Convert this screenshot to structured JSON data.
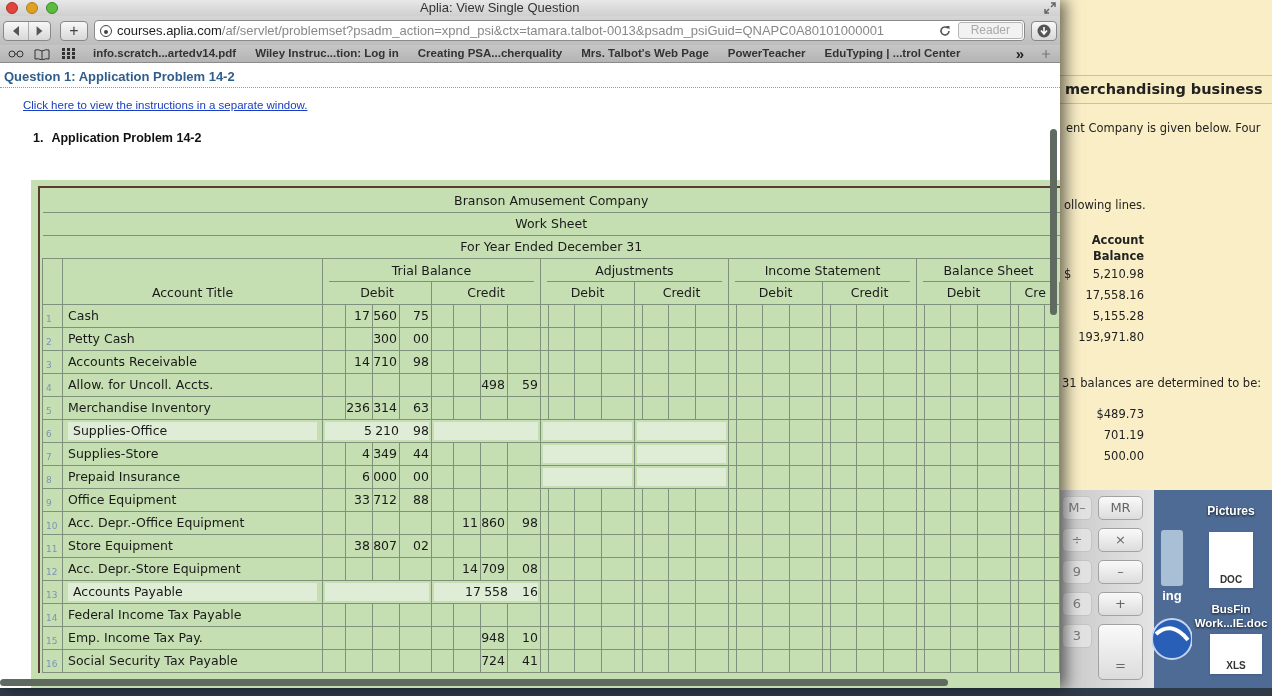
{
  "browser": {
    "title": "Aplia: View Single Question",
    "add_tab": "+",
    "url_host": "courses.aplia.com",
    "url_path": "/af/servlet/problemset?psadm_action=xpnd_psi&ctx=tamara.talbot-0013&psadm_psiGuid=QNAPC0A80101000001",
    "reader": "Reader",
    "bookmarks": [
      "info.scratch...artedv14.pdf",
      "Wiley Instruc...tion: Log in",
      "Creating PSA...cherquality",
      "Mrs. Talbot's Web Page",
      "PowerTeacher",
      "EduTyping | ...trol Center"
    ],
    "more": "»"
  },
  "page": {
    "question_title": "Question 1: Application Problem 14-2",
    "instructions_link": "Click here to view the instructions in a separate window.",
    "problem_number": "1.",
    "problem_title": "Application Problem 14-2"
  },
  "worksheet": {
    "company": "Branson Amusement Company",
    "title": "Work Sheet",
    "period": "For Year Ended December 31",
    "account_title": "Account Title",
    "sections": [
      {
        "name": "Trial Balance",
        "sides": [
          "Debit",
          "Credit"
        ]
      },
      {
        "name": "Adjustments",
        "sides": [
          "Debit",
          "Credit"
        ]
      },
      {
        "name": "Income Statement",
        "sides": [
          "Debit",
          "Credit"
        ]
      },
      {
        "name": "Balance Sheet",
        "sides": [
          "Debit",
          "Cre"
        ]
      }
    ],
    "rows": [
      {
        "num": "1",
        "title": "Cash",
        "input": false,
        "adj_input": false,
        "debit": {
          "thousands": "17",
          "units": "560",
          "cents": "75"
        }
      },
      {
        "num": "2",
        "title": "Petty Cash",
        "input": false,
        "adj_input": false,
        "debit": {
          "units": "300",
          "cents": "00"
        }
      },
      {
        "num": "3",
        "title": "Accounts Receivable",
        "input": false,
        "adj_input": false,
        "debit": {
          "thousands": "14",
          "units": "710",
          "cents": "98"
        }
      },
      {
        "num": "4",
        "title": "Allow. for Uncoll. Accts.",
        "input": false,
        "adj_input": false,
        "credit": {
          "units": "498",
          "cents": "59"
        }
      },
      {
        "num": "5",
        "title": "Merchandise Inventory",
        "input": false,
        "adj_input": false,
        "debit": {
          "thousands": "236",
          "units": "314",
          "cents": "63"
        }
      },
      {
        "num": "6",
        "title": "Supplies-Office",
        "input": true,
        "adj_input": true,
        "debit": {
          "thousands": "5",
          "units": "210",
          "cents": "98"
        }
      },
      {
        "num": "7",
        "title": "Supplies-Store",
        "input": false,
        "adj_input": true,
        "debit": {
          "thousands": "4",
          "units": "349",
          "cents": "44"
        }
      },
      {
        "num": "8",
        "title": "Prepaid Insurance",
        "input": false,
        "adj_input": true,
        "debit": {
          "thousands": "6",
          "units": "000",
          "cents": "00"
        }
      },
      {
        "num": "9",
        "title": "Office Equipment",
        "input": false,
        "adj_input": false,
        "debit": {
          "thousands": "33",
          "units": "712",
          "cents": "88"
        }
      },
      {
        "num": "10",
        "title": "Acc. Depr.-Office Equipment",
        "input": false,
        "adj_input": false,
        "credit": {
          "thousands": "11",
          "units": "860",
          "cents": "98"
        }
      },
      {
        "num": "11",
        "title": "Store Equipment",
        "input": false,
        "adj_input": false,
        "debit": {
          "thousands": "38",
          "units": "807",
          "cents": "02"
        }
      },
      {
        "num": "12",
        "title": "Acc. Depr.-Store Equipment",
        "input": false,
        "adj_input": false,
        "credit": {
          "thousands": "14",
          "units": "709",
          "cents": "08"
        }
      },
      {
        "num": "13",
        "title": "Accounts Payable",
        "input": true,
        "adj_input": false,
        "credit": {
          "thousands": "17",
          "units": "558",
          "cents": "16"
        }
      },
      {
        "num": "14",
        "title": "Federal Income Tax Payable",
        "input": false,
        "adj_input": false
      },
      {
        "num": "15",
        "title": "Emp. Income Tax Pay.",
        "input": false,
        "adj_input": false,
        "credit": {
          "units": "948",
          "cents": "10"
        }
      },
      {
        "num": "16",
        "title": "Social Security Tax Payable",
        "input": false,
        "adj_input": false,
        "credit": {
          "units": "724",
          "cents": "41"
        }
      }
    ]
  },
  "instructions_window": {
    "heading": "merchandising business",
    "intro": "ent Company is given below. Four",
    "lines_note": "ollowing lines.",
    "balance_header": [
      "Account",
      "Balance"
    ],
    "currency": "$",
    "balances": [
      "5,210.98",
      "17,558.16",
      "5,155.28",
      "193,971.80"
    ],
    "adjust_note": "31 balances are determined to be:",
    "adjusted": [
      "$489.73",
      "701.19",
      "500.00"
    ]
  },
  "calculator": {
    "columns": [
      [
        {
          "label": "M–",
          "dimmed": true
        },
        {
          "label": "÷",
          "dimmed": true
        },
        {
          "label": "9",
          "dimmed": true
        },
        {
          "label": "6",
          "dimmed": true
        },
        {
          "label": "3",
          "dimmed": true
        }
      ],
      [
        {
          "label": "MR",
          "dimmed": false
        },
        {
          "label": "×",
          "dimmed": false
        },
        {
          "label": "–",
          "dimmed": false
        },
        {
          "label": "+",
          "dimmed": false
        },
        {
          "label": "=",
          "dimmed": false
        }
      ]
    ]
  },
  "desktop": {
    "folder_label": "ing",
    "pictures_label": "Pictures",
    "files": [
      {
        "type": "DOC",
        "label": "BusFin Work...IE.doc"
      },
      {
        "type": "XLS"
      }
    ]
  }
}
